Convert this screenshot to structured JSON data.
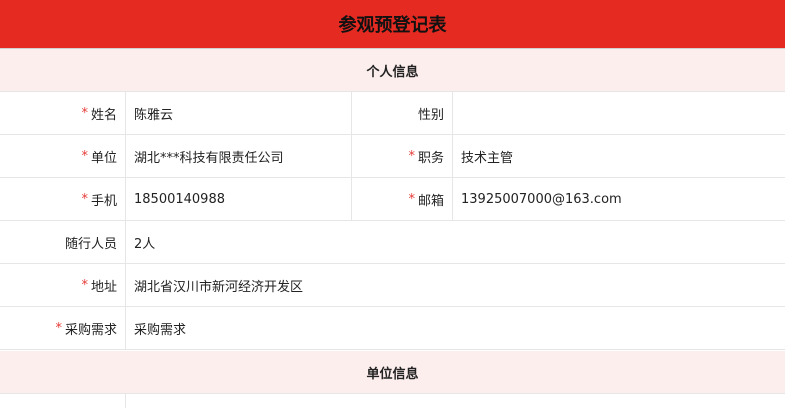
{
  "header": {
    "title": "参观预登记表"
  },
  "sections": {
    "personal": "个人信息",
    "unit": "单位信息"
  },
  "fields": {
    "name": {
      "required": true,
      "label": "姓名",
      "value": "陈雅云"
    },
    "gender": {
      "required": false,
      "label": "性别",
      "value": ""
    },
    "company": {
      "required": true,
      "label": "单位",
      "value": "湖北***科技有限责任公司"
    },
    "position": {
      "required": true,
      "label": "职务",
      "value": "技术主管"
    },
    "phone": {
      "required": true,
      "label": "手机",
      "value": "18500140988"
    },
    "email": {
      "required": true,
      "label": "邮箱",
      "value": "13925007000@163.com"
    },
    "companions": {
      "required": false,
      "label": "随行人员",
      "value": "2人"
    },
    "address": {
      "required": true,
      "label": "地址",
      "value": "湖北省汉川市新河经济开发区"
    },
    "purchase": {
      "required": true,
      "label": "采购需求",
      "value": "采购需求"
    }
  },
  "required_mark": "*",
  "colors": {
    "header_bg": "#e42a21",
    "section_bg": "#fdeeee",
    "required": "#e53935",
    "border": "#e6e6e6"
  }
}
